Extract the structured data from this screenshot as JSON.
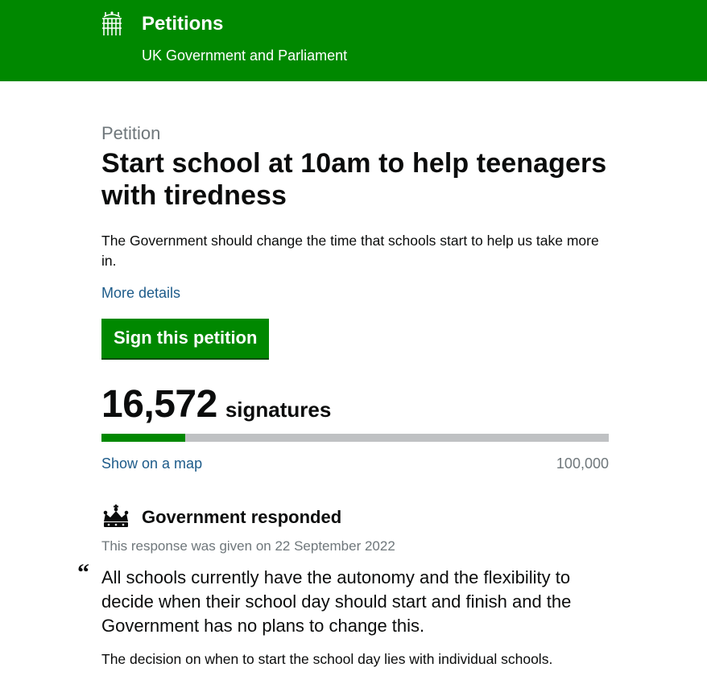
{
  "header": {
    "site_name": "Petitions",
    "site_subtitle": "UK Government and Parliament",
    "logo_icon": "portcullis-icon",
    "background": "#008800"
  },
  "petition": {
    "kicker": "Petition",
    "title": "Start school at 10am to help teenagers with tiredness",
    "summary": "The Government should change the time that schools start to help us take more in.",
    "more_details_label": "More details",
    "sign_button_label": "Sign this petition",
    "signature_count": "16,572",
    "signatures_label": "signatures",
    "progress_fraction": 0.16572,
    "threshold": "100,000",
    "show_on_map_label": "Show on a map"
  },
  "response": {
    "icon": "crown-icon",
    "heading": "Government responded",
    "given_text": "This response was given on 22 September 2022",
    "quote_mark": "“",
    "summary_quote": "All schools currently have the autonomy and the flexibility to decide when their school day should start and finish and the Government has no plans to change this.",
    "body_first_line": "The decision on when to start the school day lies with individual schools."
  },
  "colors": {
    "brand_green": "#008800",
    "link_blue": "#1d5b8a",
    "secondary_text": "#6f777b",
    "progress_track": "#bfc1c3"
  }
}
